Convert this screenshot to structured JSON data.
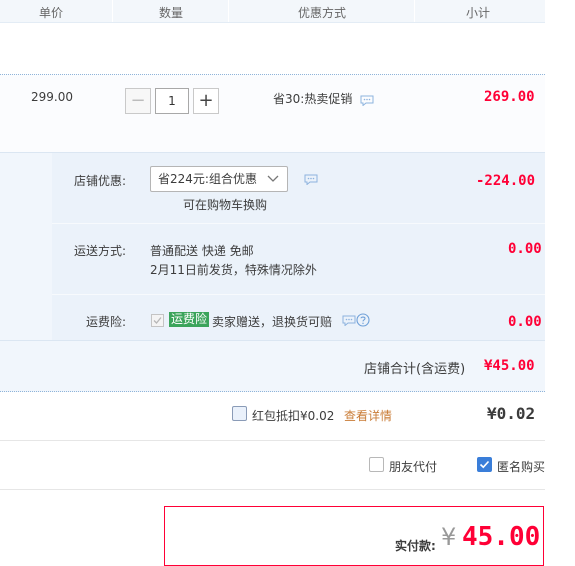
{
  "header": {
    "col_unit_price": "单价",
    "col_quantity": "数量",
    "col_discount": "优惠方式",
    "col_subtotal": "小计"
  },
  "product": {
    "unit_price": "299.00",
    "quantity": "1",
    "minus_symbol": "−",
    "plus_symbol": "+",
    "promo": "省30:热卖促销",
    "subtotal": "269.00"
  },
  "store_discount": {
    "label": "店铺优惠:",
    "selected": "省224元:组合优惠",
    "hint": "可在购物车换购",
    "amount": "-224.00"
  },
  "shipping": {
    "label": "运送方式:",
    "method": "普通配送 快递 免邮",
    "note": "2月11日前发货，特殊情况除外",
    "amount": "0.00"
  },
  "insurance": {
    "label": "运费险:",
    "badge": "运费险",
    "text": "卖家赠送，退换货可赔",
    "amount": "0.00"
  },
  "store_total": {
    "label": "店铺合计(含运费)",
    "amount": "¥45.00"
  },
  "red_packet": {
    "label": "红包抵扣¥0.02",
    "link": "查看详情",
    "amount": "¥0.02"
  },
  "options": {
    "friend_pay": "朋友代付",
    "anonymous": "匿名购买"
  },
  "payment": {
    "label": "实付款:",
    "currency": "¥",
    "amount": "45.00"
  },
  "colors": {
    "price_red": "#ff0036",
    "badge_green": "#3ba45b",
    "link_orange": "#c97c37",
    "check_blue": "#3a7ed9"
  },
  "icons": [
    "chat-icon",
    "question-icon",
    "chevron-down-icon",
    "checkbox-checked-icon"
  ]
}
